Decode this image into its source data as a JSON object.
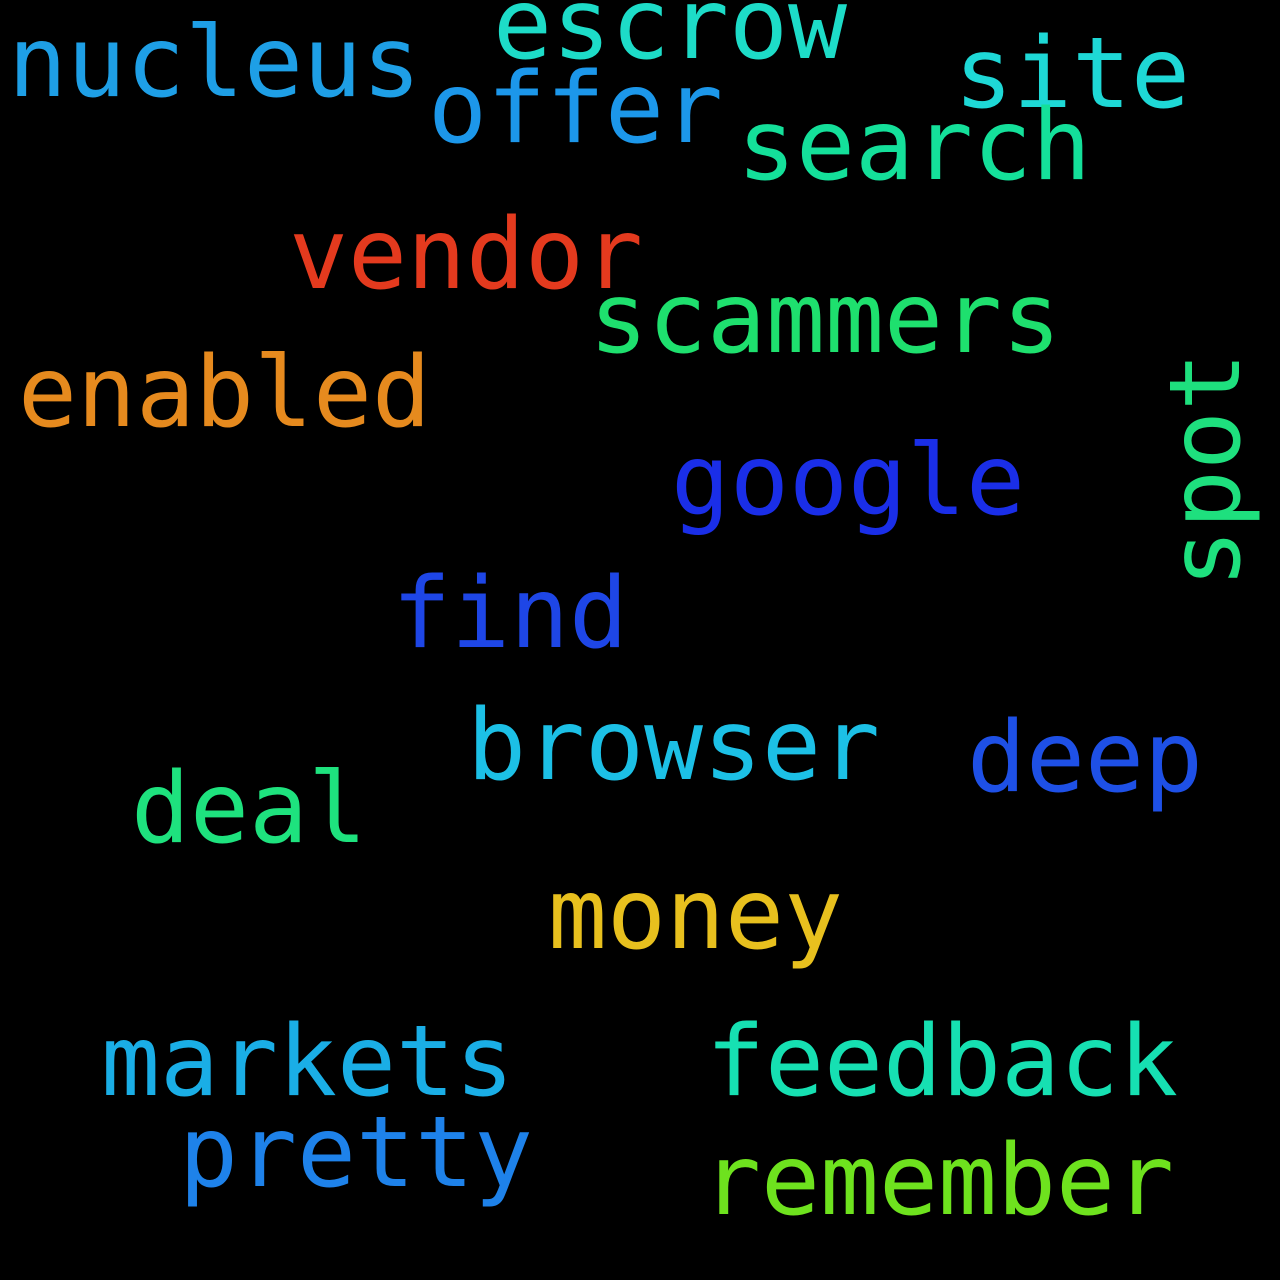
{
  "background": "#000000",
  "words": [
    {
      "key": "escrow",
      "text": "escrow",
      "color": "#1ddcc8",
      "rotated": false
    },
    {
      "key": "nucleus",
      "text": "nucleus",
      "color": "#1e9fe6",
      "rotated": false
    },
    {
      "key": "site",
      "text": "site",
      "color": "#1ed8d6",
      "rotated": false
    },
    {
      "key": "offer",
      "text": "offer",
      "color": "#1c97ea",
      "rotated": false
    },
    {
      "key": "search",
      "text": "search",
      "color": "#14e09a",
      "rotated": false
    },
    {
      "key": "vendor",
      "text": "vendor",
      "color": "#e43a1e",
      "rotated": false
    },
    {
      "key": "scammers",
      "text": "scammers",
      "color": "#1ee06e",
      "rotated": false
    },
    {
      "key": "enabled",
      "text": "enabled",
      "color": "#e68a1e",
      "rotated": false
    },
    {
      "key": "google",
      "text": "google",
      "color": "#1a2ee8",
      "rotated": false
    },
    {
      "key": "spot",
      "text": "spot",
      "color": "#1ee07e",
      "rotated": true
    },
    {
      "key": "find",
      "text": "find",
      "color": "#1e46e6",
      "rotated": false
    },
    {
      "key": "browser",
      "text": "browser",
      "color": "#1cc0e6",
      "rotated": false
    },
    {
      "key": "deep",
      "text": "deep",
      "color": "#1e50e6",
      "rotated": false
    },
    {
      "key": "deal",
      "text": "deal",
      "color": "#1ee27e",
      "rotated": false
    },
    {
      "key": "money",
      "text": "money",
      "color": "#e8c01e",
      "rotated": false
    },
    {
      "key": "markets",
      "text": "markets",
      "color": "#1aaee6",
      "rotated": false
    },
    {
      "key": "feedback",
      "text": "feedback",
      "color": "#16e0b2",
      "rotated": false
    },
    {
      "key": "pretty",
      "text": "pretty",
      "color": "#1e82ea",
      "rotated": false
    },
    {
      "key": "remember",
      "text": "remember",
      "color": "#6ee21e",
      "rotated": false
    }
  ]
}
